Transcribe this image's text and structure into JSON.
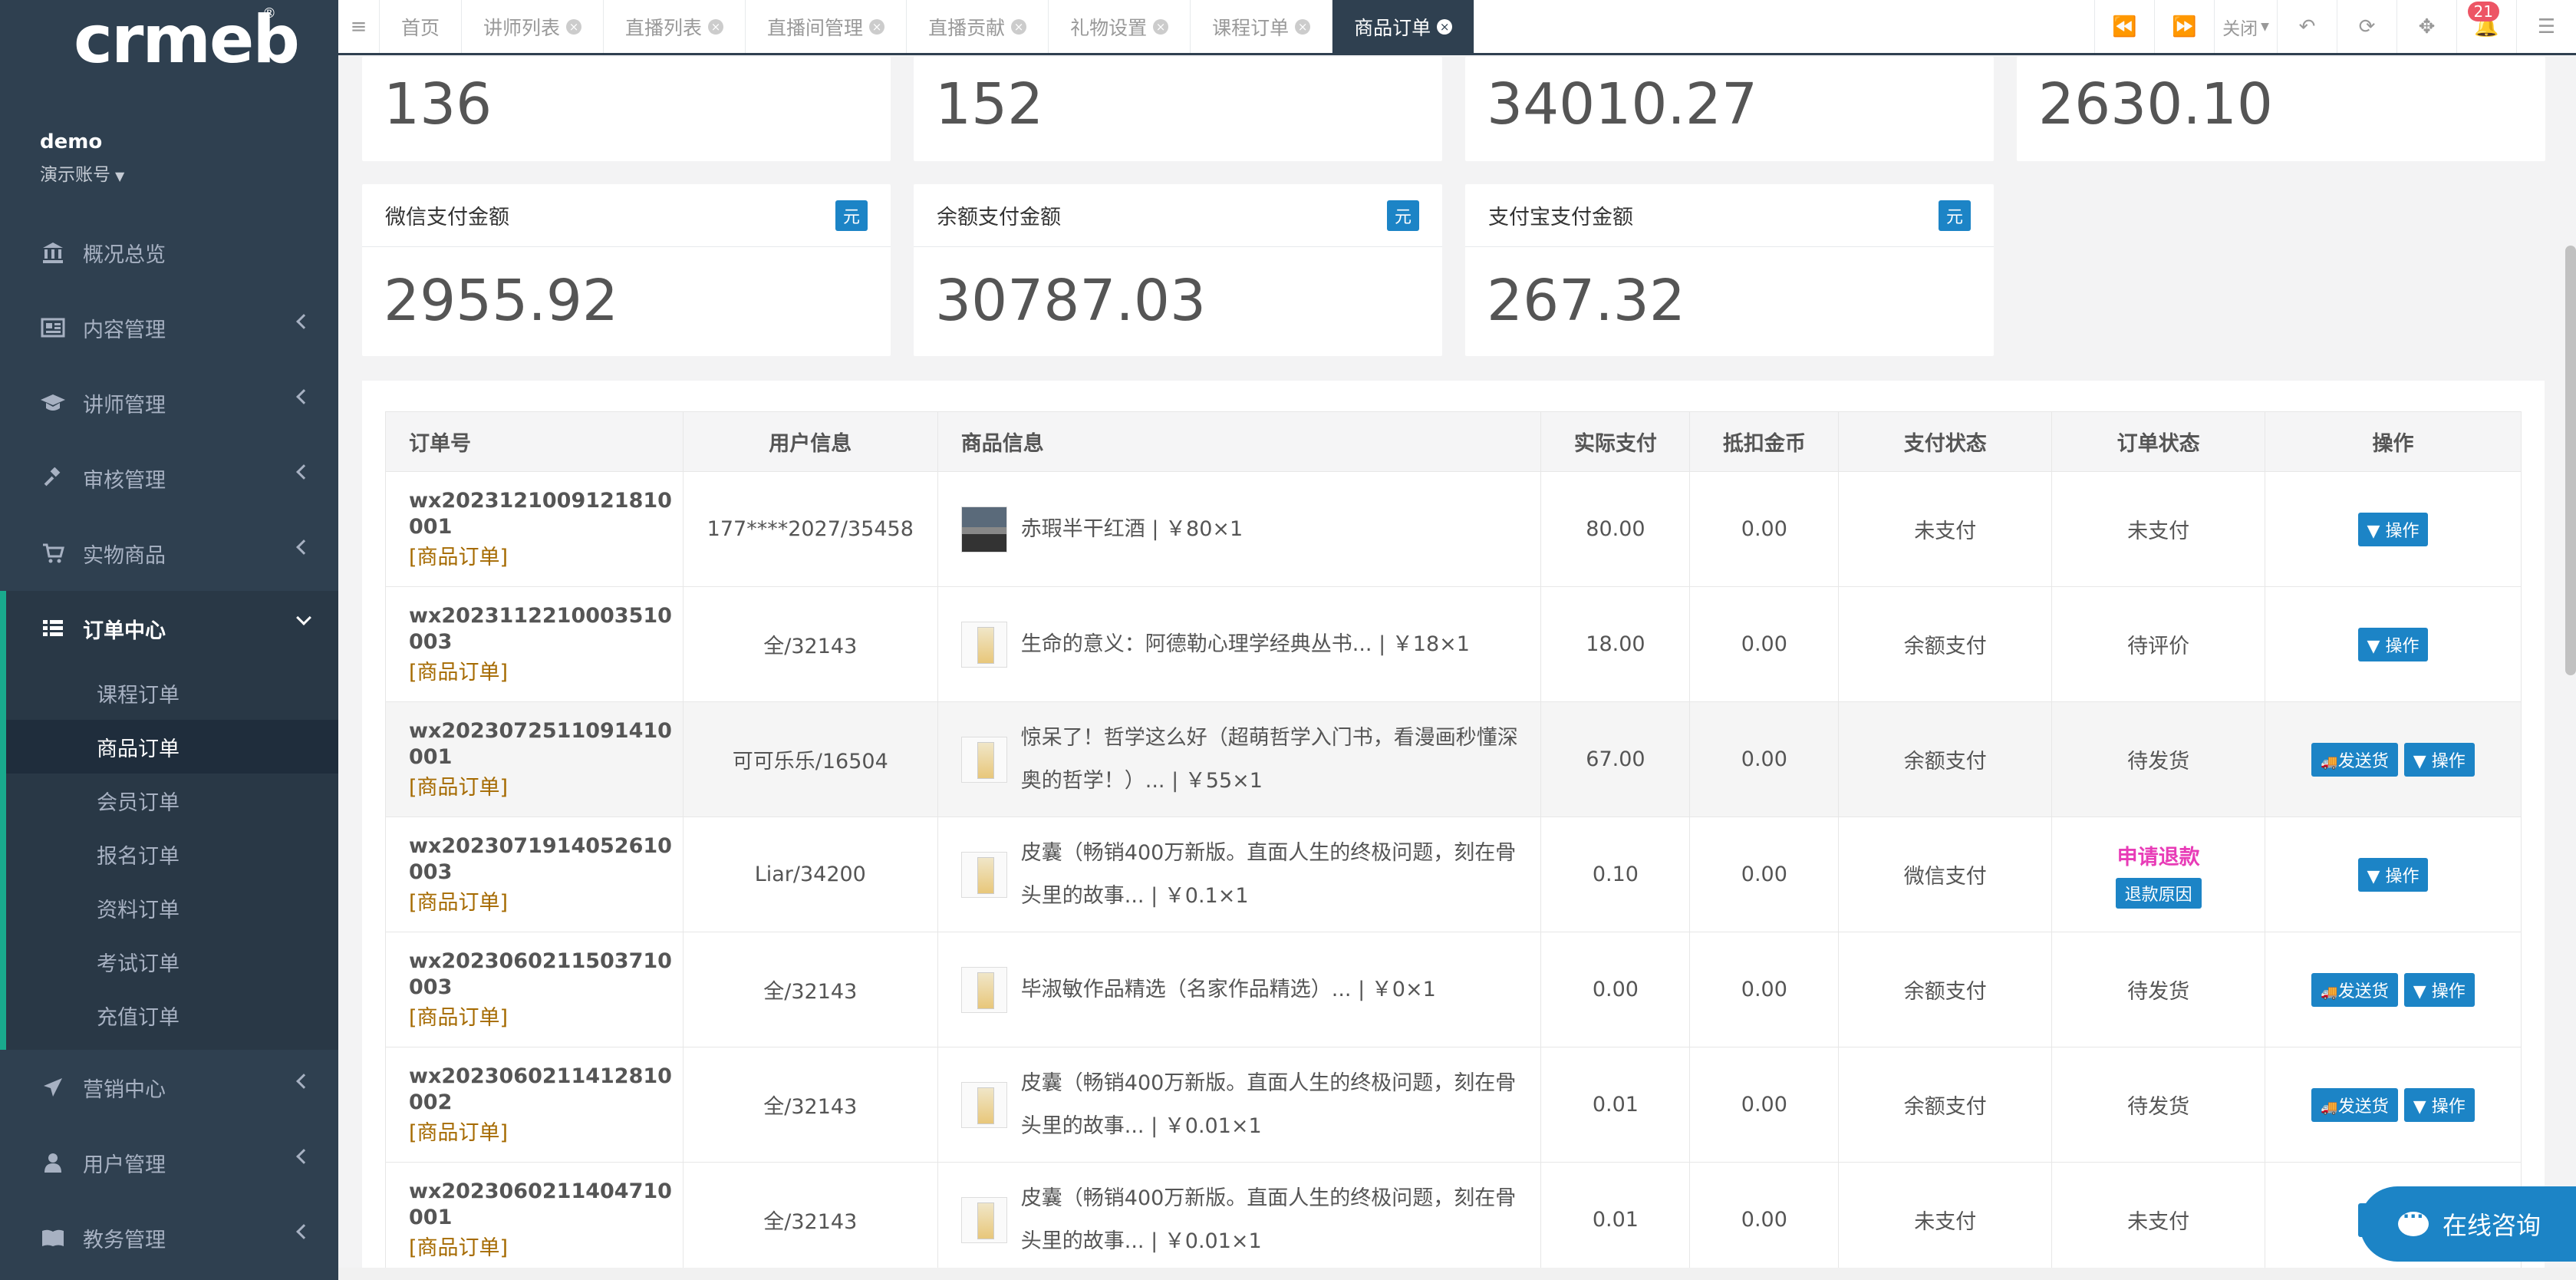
{
  "brand": {
    "logo_text": "crmeb",
    "reg_mark": "®"
  },
  "profile": {
    "name": "demo",
    "role": "演示账号"
  },
  "nav": {
    "items": [
      {
        "label": "概况总览",
        "icon": "bank-icon"
      },
      {
        "label": "内容管理",
        "icon": "newspaper-icon"
      },
      {
        "label": "讲师管理",
        "icon": "graduation-cap-icon"
      },
      {
        "label": "审核管理",
        "icon": "gavel-icon"
      },
      {
        "label": "实物商品",
        "icon": "cart-icon"
      },
      {
        "label": "订单中心",
        "icon": "list-icon"
      }
    ],
    "sub_items": [
      "课程订单",
      "商品订单",
      "会员订单",
      "报名订单",
      "资料订单",
      "考试订单",
      "充值订单"
    ],
    "items_after": [
      {
        "label": "营销中心",
        "icon": "send-icon"
      },
      {
        "label": "用户管理",
        "icon": "user-icon"
      },
      {
        "label": "教务管理",
        "icon": "book-icon"
      }
    ]
  },
  "tabs": [
    "首页",
    "讲师列表",
    "直播列表",
    "直播间管理",
    "直播贡献",
    "礼物设置",
    "课程订单",
    "商品订单"
  ],
  "topbar": {
    "close_label": "关闭",
    "notify_count": "21"
  },
  "stats_top": [
    "136",
    "152",
    "34010.27",
    "2630.10"
  ],
  "stats": [
    {
      "label": "微信支付金额",
      "unit": "元",
      "value": "2955.92"
    },
    {
      "label": "余额支付金额",
      "unit": "元",
      "value": "30787.03"
    },
    {
      "label": "支付宝支付金额",
      "unit": "元",
      "value": "267.32"
    }
  ],
  "table": {
    "headers": [
      "订单号",
      "用户信息",
      "商品信息",
      "实际支付",
      "抵扣金币",
      "支付状态",
      "订单状态",
      "操作"
    ],
    "ship_label": "发送货",
    "op_label": "操作",
    "order_tag": "[商品订单]",
    "reason_label": "退款原因",
    "rows": [
      {
        "order_no": "wx2023121009121810001",
        "user": "177****2027/35458",
        "goods": "赤瑕半干红酒 | ￥80×1",
        "paid": "80.00",
        "coin": "0.00",
        "pay_status": "未支付",
        "order_status": "未支付"
      },
      {
        "order_no": "wx2023112210003510003",
        "user": "全/32143",
        "goods": "生命的意义：阿德勒心理学经典丛书... | ￥18×1",
        "paid": "18.00",
        "coin": "0.00",
        "pay_status": "余额支付",
        "order_status": "待评价"
      },
      {
        "order_no": "wx2023072511091410001",
        "user": "可可乐乐/16504",
        "goods": "惊呆了！哲学这么好（超萌哲学入门书，看漫画秒懂深奥的哲学！）... | ￥55×1",
        "paid": "67.00",
        "coin": "0.00",
        "pay_status": "余额支付",
        "order_status": "待发货"
      },
      {
        "order_no": "wx2023071914052610003",
        "user": "Liar/34200",
        "goods": "皮囊（畅销400万新版。直面人生的终极问题，刻在骨头里的故事... | ￥0.1×1",
        "paid": "0.10",
        "coin": "0.00",
        "pay_status": "微信支付",
        "order_status": "申请退款"
      },
      {
        "order_no": "wx2023060211503710003",
        "user": "全/32143",
        "goods": "毕淑敏作品精选（名家作品精选）... | ￥0×1",
        "paid": "0.00",
        "coin": "0.00",
        "pay_status": "余额支付",
        "order_status": "待发货"
      },
      {
        "order_no": "wx2023060211412810002",
        "user": "全/32143",
        "goods": "皮囊（畅销400万新版。直面人生的终极问题，刻在骨头里的故事... | ￥0.01×1",
        "paid": "0.01",
        "coin": "0.00",
        "pay_status": "余额支付",
        "order_status": "待发货"
      },
      {
        "order_no": "wx2023060211404710001",
        "user": "全/32143",
        "goods": "皮囊（畅销400万新版。直面人生的终极问题，刻在骨头里的故事... | ￥0.01×1",
        "paid": "0.01",
        "coin": "0.00",
        "pay_status": "未支付",
        "order_status": "未支付"
      }
    ]
  },
  "consult": {
    "label": "在线咨询"
  }
}
